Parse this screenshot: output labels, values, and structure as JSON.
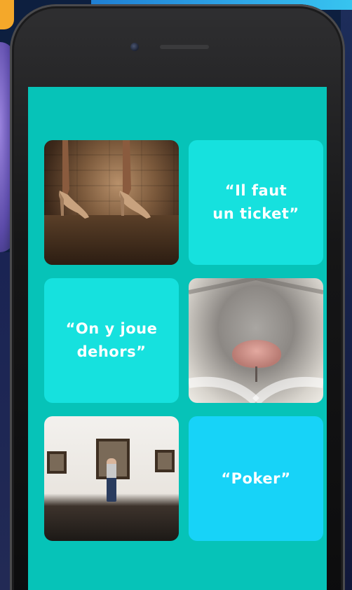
{
  "tiles": [
    {
      "kind": "photo",
      "subject": "heels-photo"
    },
    {
      "kind": "text",
      "label": "“Il faut\nun ticket”"
    },
    {
      "kind": "text",
      "label": "“On y joue\ndehors”"
    },
    {
      "kind": "photo",
      "subject": "cat-nose-photo"
    },
    {
      "kind": "photo",
      "subject": "museum-photo"
    },
    {
      "kind": "text",
      "label": "“Poker”"
    }
  ],
  "colors": {
    "screen_bg": "#06c3b8",
    "tile_teal": "#16e1de",
    "tile_blue": "#17d3f8"
  }
}
